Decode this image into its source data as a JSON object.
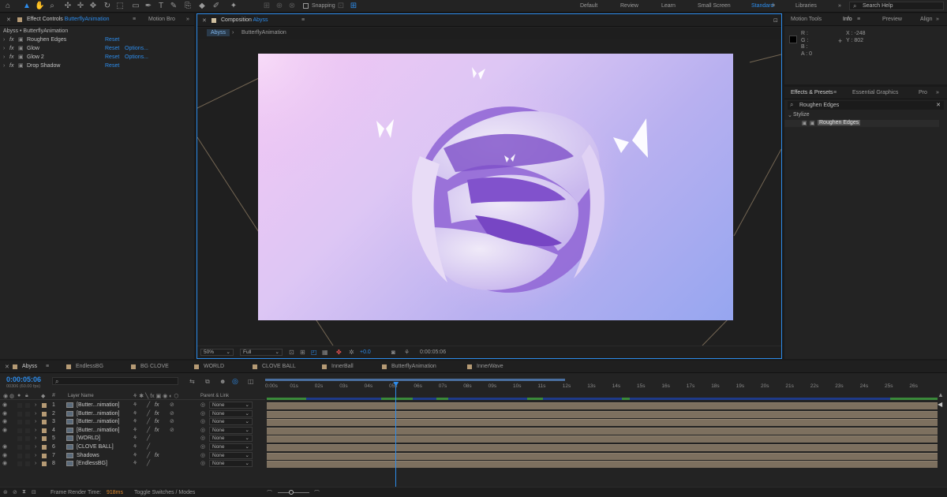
{
  "workspaces": {
    "default": "Default",
    "review": "Review",
    "learn": "Learn",
    "small_screen": "Small Screen",
    "standard": "Standard",
    "libraries": "Libraries",
    "search_help": "Search Help"
  },
  "toolbar": {
    "snapping": "Snapping"
  },
  "effect_controls": {
    "tab_label": "Effect Controls",
    "tab_layer": "ButterflyAnimation",
    "tab_other": "Motion Bro",
    "breadcrumb": "Abyss • ButterflyAnimation",
    "effects": [
      {
        "name": "Roughen Edges",
        "reset": "Reset",
        "options": ""
      },
      {
        "name": "Glow",
        "reset": "Reset",
        "options": "Options..."
      },
      {
        "name": "Glow 2",
        "reset": "Reset",
        "options": "Options..."
      },
      {
        "name": "Drop Shadow",
        "reset": "Reset",
        "options": ""
      }
    ]
  },
  "composition": {
    "tab_label": "Composition",
    "tab_name": "Abyss",
    "nav_active": "Abyss",
    "nav_other": "ButterflyAnimation",
    "zoom": "50%",
    "resolution": "Full",
    "exposure": "+0.0",
    "timecode": "0:00:05:06"
  },
  "right_panel": {
    "tabs": [
      "Motion Tools",
      "Info",
      "Preview",
      "Align"
    ],
    "info": {
      "r": "R :",
      "g": "G :",
      "b": "B :",
      "a": "A : 0",
      "x": "X : -248",
      "y": "Y : 802"
    },
    "effects_tabs": [
      "Effects & Presets",
      "Essential Graphics",
      "Pro"
    ],
    "search_value": "Roughen Edges",
    "category": "Stylize",
    "result": "Roughen Edges"
  },
  "timeline": {
    "tabs": [
      "Abyss",
      "EndlessBG",
      "BG CLOVE",
      "WORLD",
      "CLOVE BALL",
      "InnerBall",
      "ButterflyAnimation",
      "InnerWave"
    ],
    "timecode": "0:00:05:06",
    "frames": "00306 (60.00 fps)",
    "header_layer_name": "Layer Name",
    "header_parent": "Parent & Link",
    "ticks": [
      "0:00s",
      "01s",
      "02s",
      "03s",
      "04s",
      "05s",
      "06s",
      "07s",
      "08s",
      "09s",
      "10s",
      "11s",
      "12s",
      "13s",
      "14s",
      "15s",
      "16s",
      "17s",
      "18s",
      "19s",
      "20s",
      "21s",
      "22s",
      "23s",
      "24s",
      "25s",
      "26s"
    ],
    "layers": [
      {
        "num": "1",
        "name": "[Butter...nimation]",
        "parent": "None",
        "fx": "fx"
      },
      {
        "num": "2",
        "name": "[Butter...nimation]",
        "parent": "None",
        "fx": "fx"
      },
      {
        "num": "3",
        "name": "[Butter...nimation]",
        "parent": "None",
        "fx": "fx"
      },
      {
        "num": "4",
        "name": "[Butter...nimation]",
        "parent": "None",
        "fx": "fx"
      },
      {
        "num": "5",
        "name": "[WORLD]",
        "parent": "None",
        "fx": ""
      },
      {
        "num": "6",
        "name": "[CLOVE BALL]",
        "parent": "None",
        "fx": ""
      },
      {
        "num": "7",
        "name": "Shadows",
        "parent": "None",
        "fx": "fx"
      },
      {
        "num": "8",
        "name": "[EndlessBG]",
        "parent": "None",
        "fx": ""
      }
    ],
    "playhead_fraction": 0.1967
  },
  "status": {
    "render_label": "Frame Render Time:",
    "render_value": "918ms",
    "toggle": "Toggle Switches / Modes"
  },
  "colors": {
    "accent": "#2d8ceb",
    "layer_swatch": "#b59a74",
    "track_bar": "#7d705f",
    "render_time": "#e08a2c"
  }
}
